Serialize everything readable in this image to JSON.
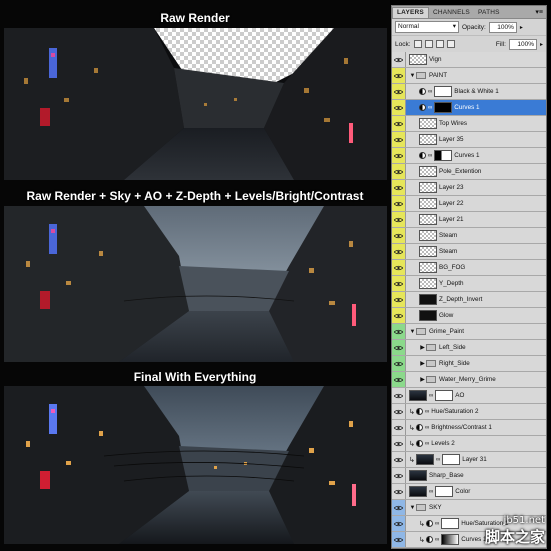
{
  "captions": {
    "raw": "Raw Render",
    "composite": "Raw Render + Sky + AO + Z-Depth + Levels/Bright/Contrast",
    "final": "Final With Everything"
  },
  "panel": {
    "tabs": [
      "LAYERS",
      "CHANNELS",
      "PATHS"
    ],
    "blend_mode": "Normal",
    "opacity_label": "Opacity:",
    "opacity_value": "100%",
    "lock_label": "Lock:",
    "fill_label": "Fill:",
    "fill_value": "100%"
  },
  "layers": [
    {
      "name": "Vign",
      "eye": "n",
      "type": "pixel",
      "indent": 0,
      "thumb": "check"
    },
    {
      "name": "PAINT",
      "eye": "y",
      "type": "group",
      "indent": 0,
      "open": true
    },
    {
      "name": "Black & White 1",
      "eye": "y",
      "type": "adjust",
      "indent": 1,
      "thumb": "white"
    },
    {
      "name": "Curves 1",
      "eye": "y",
      "type": "adjust",
      "indent": 1,
      "thumb": "black",
      "selected": true
    },
    {
      "name": "Top Wires",
      "eye": "y",
      "type": "pixel",
      "indent": 1,
      "thumb": "check"
    },
    {
      "name": "Layer 35",
      "eye": "y",
      "type": "pixel",
      "indent": 1,
      "thumb": "check"
    },
    {
      "name": "Curves 1",
      "eye": "y",
      "type": "adjust",
      "indent": 1,
      "thumb": "blackwhite"
    },
    {
      "name": "Pole_Extention",
      "eye": "y",
      "type": "pixel",
      "indent": 1,
      "thumb": "check"
    },
    {
      "name": "Layer 23",
      "eye": "y",
      "type": "pixel",
      "indent": 1,
      "thumb": "check"
    },
    {
      "name": "Layer 22",
      "eye": "y",
      "type": "pixel",
      "indent": 1,
      "thumb": "check"
    },
    {
      "name": "Layer 21",
      "eye": "y",
      "type": "pixel",
      "indent": 1,
      "thumb": "check"
    },
    {
      "name": "Steam",
      "eye": "y",
      "type": "pixel",
      "indent": 1,
      "thumb": "check"
    },
    {
      "name": "Steam",
      "eye": "y",
      "type": "pixel",
      "indent": 1,
      "thumb": "check"
    },
    {
      "name": "BG_FOG",
      "eye": "y",
      "type": "pixel",
      "indent": 1,
      "thumb": "check"
    },
    {
      "name": "Y_Depth",
      "eye": "y",
      "type": "pixel",
      "indent": 1,
      "thumb": "check"
    },
    {
      "name": "Z_Depth_Invert",
      "eye": "y",
      "type": "pixel",
      "indent": 1,
      "thumb": "dark"
    },
    {
      "name": "Glow",
      "eye": "y",
      "type": "pixel",
      "indent": 1,
      "thumb": "dark"
    },
    {
      "name": "Grime_Paint",
      "eye": "g",
      "type": "group",
      "indent": 0,
      "open": true
    },
    {
      "name": "Left_Side",
      "eye": "g",
      "type": "group",
      "indent": 1,
      "open": false
    },
    {
      "name": "Right_Side",
      "eye": "g",
      "type": "group",
      "indent": 1,
      "open": false
    },
    {
      "name": "Water_Merry_Grime",
      "eye": "g",
      "type": "group",
      "indent": 1,
      "open": false
    },
    {
      "name": "AO",
      "eye": "n",
      "type": "pixel2",
      "indent": 0,
      "thumb": "scene"
    },
    {
      "name": "Hue/Saturation 2",
      "eye": "n",
      "type": "adjust",
      "indent": 0,
      "clip": true
    },
    {
      "name": "Brightness/Contrast 1",
      "eye": "n",
      "type": "adjust",
      "indent": 0,
      "clip": true
    },
    {
      "name": "Levels 2",
      "eye": "n",
      "type": "adjust",
      "indent": 0,
      "clip": true
    },
    {
      "name": "Layer 31",
      "eye": "n",
      "type": "pixel2",
      "indent": 0,
      "thumb": "scene",
      "clip": true
    },
    {
      "name": "Sharp_Base",
      "eye": "n",
      "type": "pixel",
      "indent": 0,
      "thumb": "scene"
    },
    {
      "name": "Color",
      "eye": "n",
      "type": "pixel2",
      "indent": 0,
      "thumb": "scene"
    },
    {
      "name": "SKY",
      "eye": "b",
      "type": "group",
      "indent": 0,
      "open": true
    },
    {
      "name": "Hue/Saturation 1",
      "eye": "b",
      "type": "adjust",
      "indent": 1,
      "thumb": "white",
      "clip": true
    },
    {
      "name": "Curves 1",
      "eye": "b",
      "type": "adjust",
      "indent": 1,
      "thumb": "grad",
      "clip": true
    },
    {
      "name": "",
      "eye": "b",
      "type": "adjust",
      "indent": 1,
      "thumb": "white",
      "clip": true
    }
  ],
  "watermark": {
    "line1": "jb51.net",
    "line2": "脚本之家"
  },
  "colors": {
    "selected": "#3a7bd5",
    "eye_yellow": "#e6e65a",
    "eye_green": "#8bd98b",
    "eye_blue": "#8fb7e6"
  }
}
